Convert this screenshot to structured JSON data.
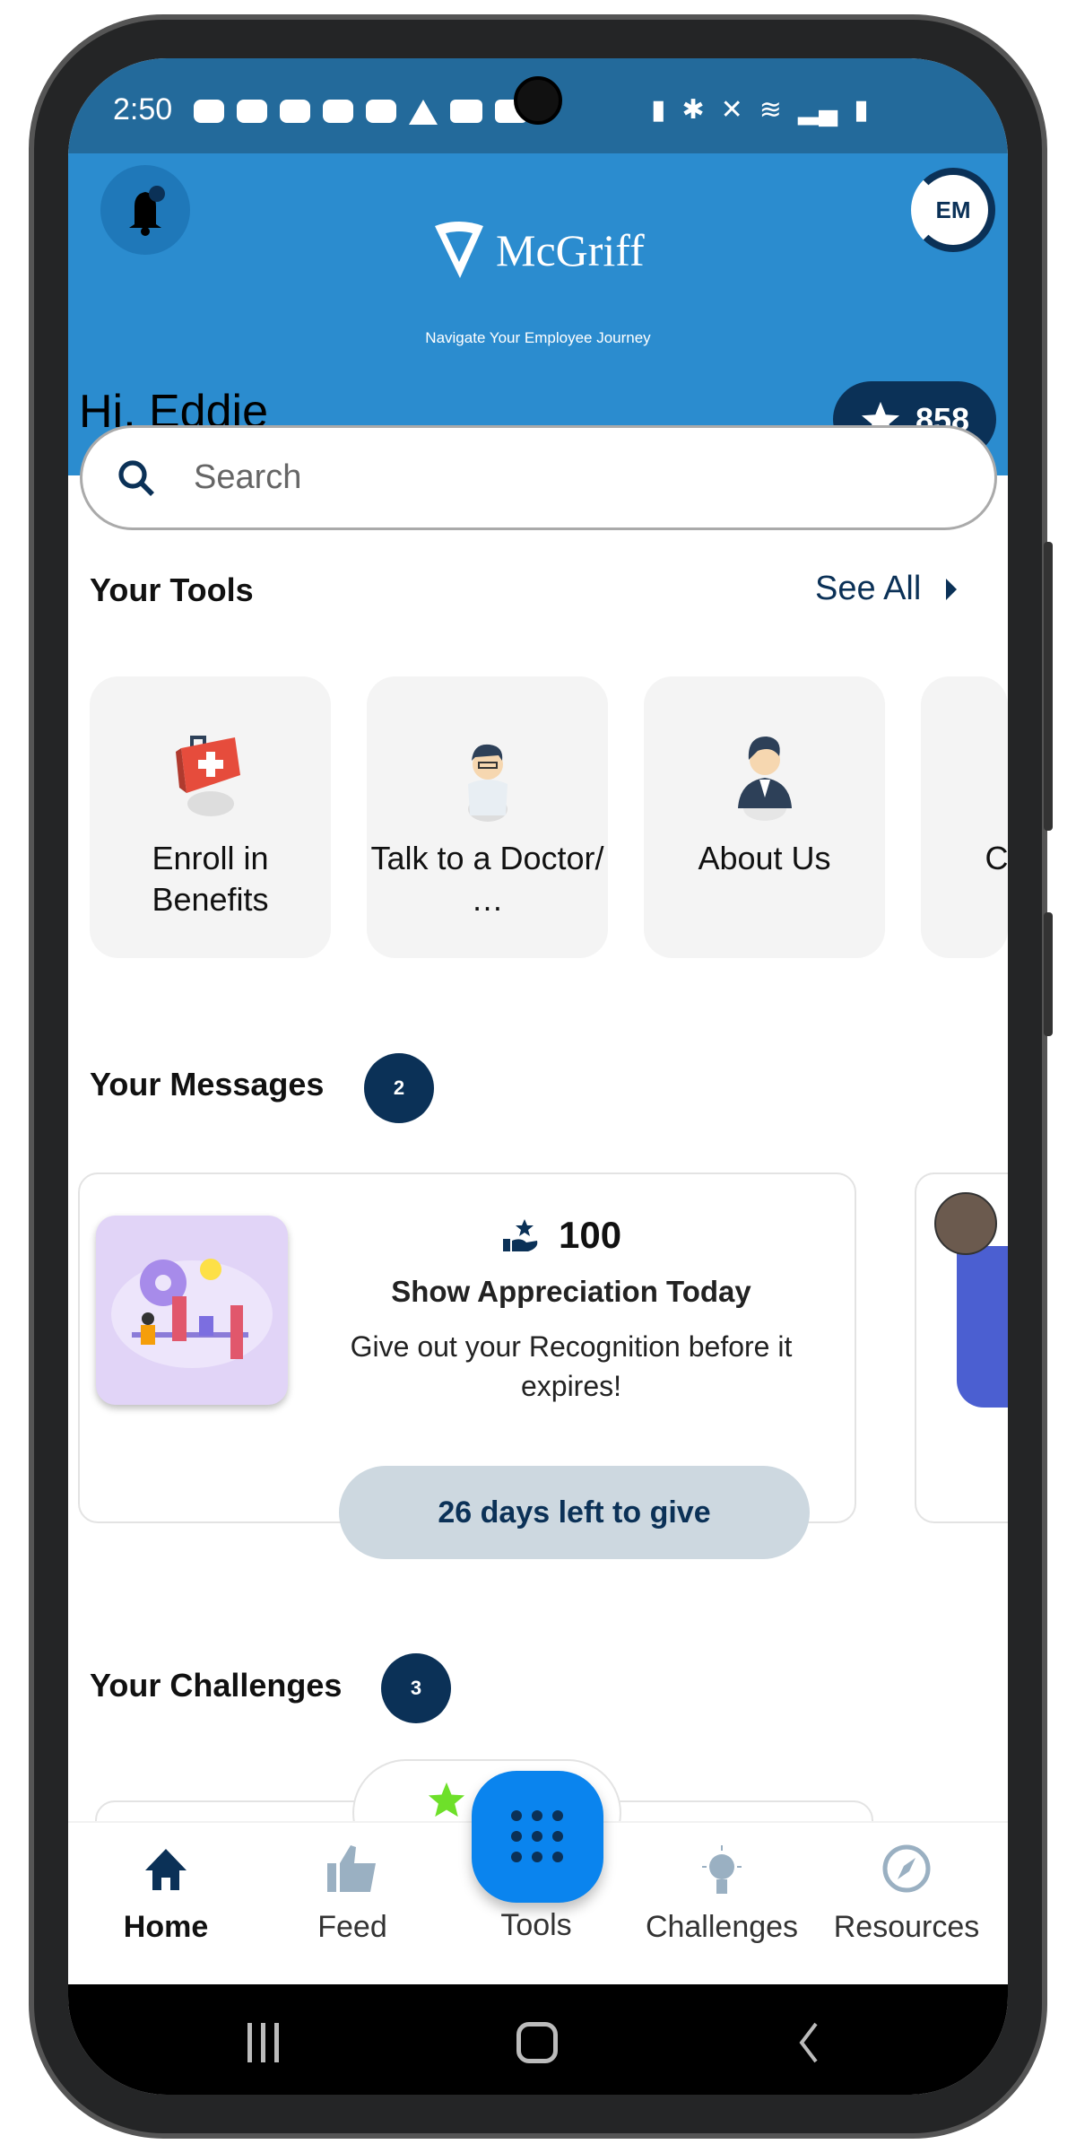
{
  "status_bar": {
    "time": "2:50"
  },
  "header": {
    "brand": "McGriff",
    "tagline": "Navigate Your Employee Journey",
    "avatar_initials": "EM",
    "greeting": "Hi, Eddie",
    "points": "858"
  },
  "search": {
    "placeholder": "Search"
  },
  "tools": {
    "title": "Your Tools",
    "see_all": "See All",
    "items": [
      {
        "label": "Enroll in Benefits",
        "icon": "first-aid-kit"
      },
      {
        "label": "Talk to a Doctor/ …",
        "icon": "doctor"
      },
      {
        "label": "About Us",
        "icon": "businessman"
      },
      {
        "label": "Ch FSA",
        "icon": "unknown"
      }
    ]
  },
  "messages": {
    "title": "Your Messages",
    "count": "2",
    "card": {
      "points": "100",
      "title": "Show Appreciation Today",
      "description": "Give out your Recognition before it expires!",
      "button": "26 days left to give"
    }
  },
  "challenges": {
    "title": "Your Challenges",
    "count": "3"
  },
  "bottom_nav": {
    "items": [
      {
        "label": "Home",
        "icon": "home-icon",
        "active": true
      },
      {
        "label": "Feed",
        "icon": "thumbs-up-icon"
      },
      {
        "label": "Tools",
        "icon": "grid-icon"
      },
      {
        "label": "Challenges",
        "icon": "lightbulb-icon"
      },
      {
        "label": "Resources",
        "icon": "compass-icon"
      }
    ]
  },
  "colors": {
    "header_blue": "#2b8ccf",
    "status_blue": "#236a9b",
    "navy": "#0b3157",
    "fab_blue": "#0a84ee"
  }
}
